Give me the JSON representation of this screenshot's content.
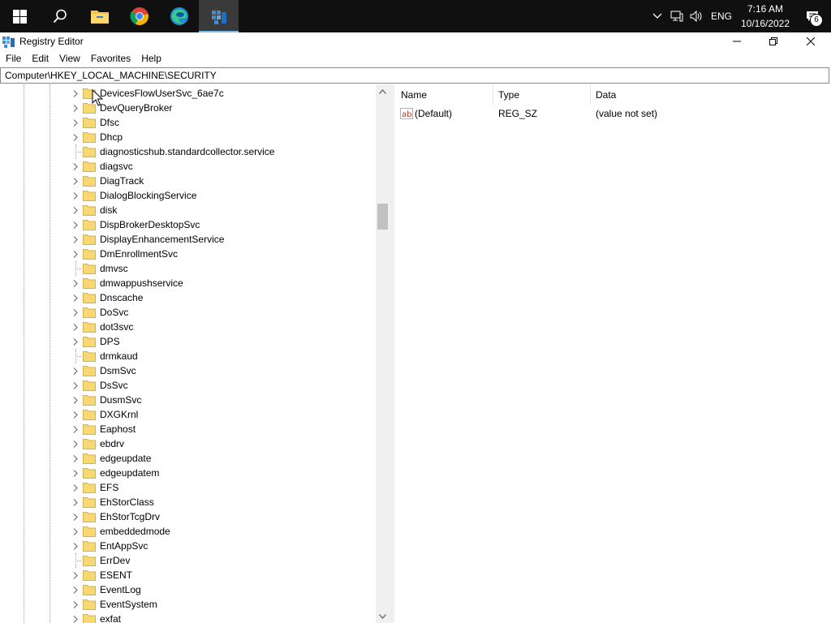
{
  "taskbar": {
    "start_icon": "windows-logo-icon",
    "search_icon": "search-icon",
    "pinned": [
      "file-explorer-icon",
      "chrome-icon",
      "edge-icon",
      "registry-editor-icon"
    ],
    "tray": {
      "language": "ENG",
      "time": "7:16 AM",
      "date": "10/16/2022",
      "notification_count": "6"
    }
  },
  "window": {
    "title": "Registry Editor",
    "menu": [
      "File",
      "Edit",
      "View",
      "Favorites",
      "Help"
    ],
    "address": "Computer\\HKEY_LOCAL_MACHINE\\SECURITY"
  },
  "tree": {
    "nodes": [
      {
        "label": "DevicesFlowUserSvc_6ae7c",
        "expandable": true
      },
      {
        "label": "DevQueryBroker",
        "expandable": true
      },
      {
        "label": "Dfsc",
        "expandable": true
      },
      {
        "label": "Dhcp",
        "expandable": true
      },
      {
        "label": "diagnosticshub.standardcollector.service",
        "expandable": false
      },
      {
        "label": "diagsvc",
        "expandable": true
      },
      {
        "label": "DiagTrack",
        "expandable": true
      },
      {
        "label": "DialogBlockingService",
        "expandable": true
      },
      {
        "label": "disk",
        "expandable": true
      },
      {
        "label": "DispBrokerDesktopSvc",
        "expandable": true
      },
      {
        "label": "DisplayEnhancementService",
        "expandable": true
      },
      {
        "label": "DmEnrollmentSvc",
        "expandable": true
      },
      {
        "label": "dmvsc",
        "expandable": false
      },
      {
        "label": "dmwappushservice",
        "expandable": true
      },
      {
        "label": "Dnscache",
        "expandable": true
      },
      {
        "label": "DoSvc",
        "expandable": true
      },
      {
        "label": "dot3svc",
        "expandable": true
      },
      {
        "label": "DPS",
        "expandable": true
      },
      {
        "label": "drmkaud",
        "expandable": false
      },
      {
        "label": "DsmSvc",
        "expandable": true
      },
      {
        "label": "DsSvc",
        "expandable": true
      },
      {
        "label": "DusmSvc",
        "expandable": true
      },
      {
        "label": "DXGKrnl",
        "expandable": true
      },
      {
        "label": "Eaphost",
        "expandable": true
      },
      {
        "label": "ebdrv",
        "expandable": true
      },
      {
        "label": "edgeupdate",
        "expandable": true
      },
      {
        "label": "edgeupdatem",
        "expandable": true
      },
      {
        "label": "EFS",
        "expandable": true
      },
      {
        "label": "EhStorClass",
        "expandable": true
      },
      {
        "label": "EhStorTcgDrv",
        "expandable": true
      },
      {
        "label": "embeddedmode",
        "expandable": true
      },
      {
        "label": "EntAppSvc",
        "expandable": true
      },
      {
        "label": "ErrDev",
        "expandable": false
      },
      {
        "label": "ESENT",
        "expandable": true
      },
      {
        "label": "EventLog",
        "expandable": true
      },
      {
        "label": "EventSystem",
        "expandable": true
      },
      {
        "label": "exfat",
        "expandable": true
      }
    ]
  },
  "list": {
    "columns": [
      "Name",
      "Type",
      "Data"
    ],
    "rows": [
      {
        "name": "(Default)",
        "type": "REG_SZ",
        "data": "(value not set)",
        "icon": "string-value-icon"
      }
    ]
  },
  "colors": {
    "taskbar_bg": "#101010",
    "folder_yellow": "#f8d775",
    "accent": "#76b9ed"
  }
}
